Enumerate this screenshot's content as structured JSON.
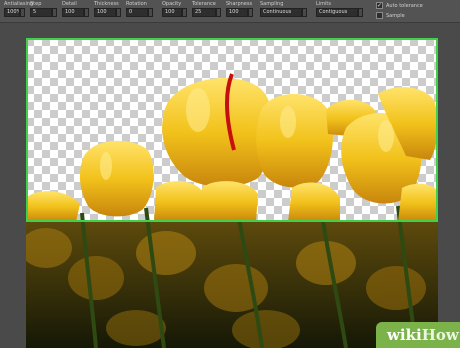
{
  "options": [
    {
      "id": "antialias",
      "label": "Antialiasing",
      "value": "100%"
    },
    {
      "id": "step",
      "label": "Step",
      "value": "5"
    },
    {
      "id": "detail",
      "label": "Detail",
      "value": "100"
    },
    {
      "id": "thickness",
      "label": "Thickness",
      "value": "100"
    },
    {
      "id": "rotation",
      "label": "Rotation",
      "value": "0"
    },
    {
      "id": "opacity",
      "label": "Opacity",
      "value": "100"
    },
    {
      "id": "tolerance",
      "label": "Tolerance",
      "value": "25"
    },
    {
      "id": "sharpness",
      "label": "Sharpness",
      "value": "100"
    },
    {
      "id": "sampling",
      "label": "Sampling",
      "value": "Continuous"
    },
    {
      "id": "limits",
      "label": "Limits",
      "value": "Contiguous"
    }
  ],
  "checkboxes": [
    {
      "id": "auto-tolerance",
      "label": "Auto tolerance",
      "checked": true
    },
    {
      "id": "sample-all",
      "label": "Sample",
      "checked": false
    }
  ],
  "watermark": {
    "brand": "wiki",
    "brand2": "How"
  },
  "colors": {
    "selection": "#3fd14a",
    "tulip": "#f2c21b",
    "watermark_bg": "#7bb34a"
  }
}
